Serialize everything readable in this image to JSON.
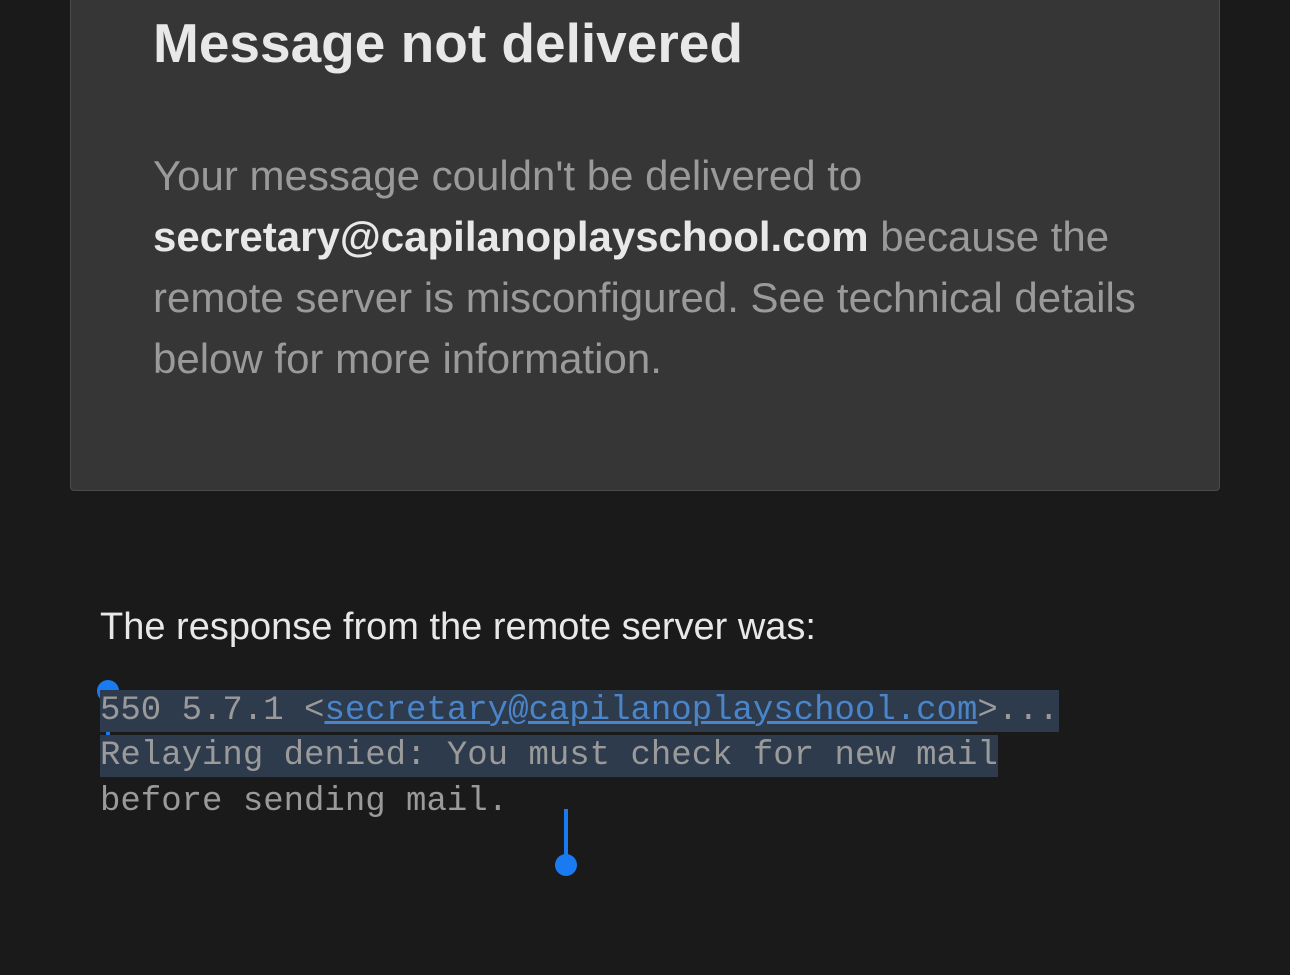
{
  "card": {
    "title": "Message not delivered",
    "body_prefix": "Your message couldn't be delivered to ",
    "recipient": "secretary@capilanoplayschool.com",
    "body_suffix": " because the remote server is misconfigured. See technical details below for more information."
  },
  "tech": {
    "response_label": "The response from the remote server was:",
    "code_prefix": "550 5.7.1 <",
    "code_link": "secretary@capilanoplayschool.com",
    "code_after_link": ">... ",
    "code_line2": "Relaying denied: You must check for new mail ",
    "code_line3": "before sending mail."
  }
}
